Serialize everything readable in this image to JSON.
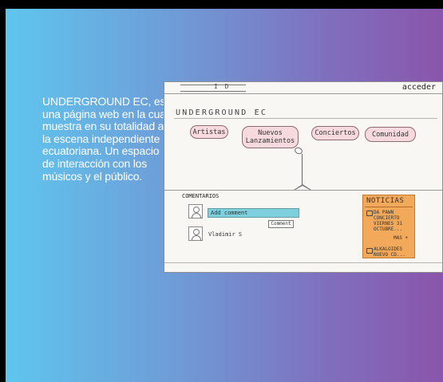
{
  "description": "UNDERGROUND EC, es una página web en la cual muestra en su totalidad a la escena independiente ecuatoriana. Un espacio de interacción con los músicos y el público.",
  "mockup": {
    "header": {
      "logo_text": "I D",
      "login_link": "acceder"
    },
    "site_title": "UNDERGROUND EC",
    "nav": [
      {
        "label": "Artistas"
      },
      {
        "label": "Nuevos Lanzamientos"
      },
      {
        "label": "Conciertos"
      },
      {
        "label": "Comunidad"
      }
    ],
    "comments": {
      "heading": "COMENTARIOS",
      "input_placeholder": "Add comment",
      "submit_label": "Comment",
      "commenter_name": "Vladimir S"
    },
    "news": {
      "title": "NOTICIAS",
      "items": [
        {
          "text": "DA PAWN\nCONCIERTO\nVIERNES 31\nOCTUBRE..."
        },
        {
          "text": "ALKALOIDES\nNUEVO CD..."
        }
      ],
      "more_label": "MAS +"
    }
  }
}
